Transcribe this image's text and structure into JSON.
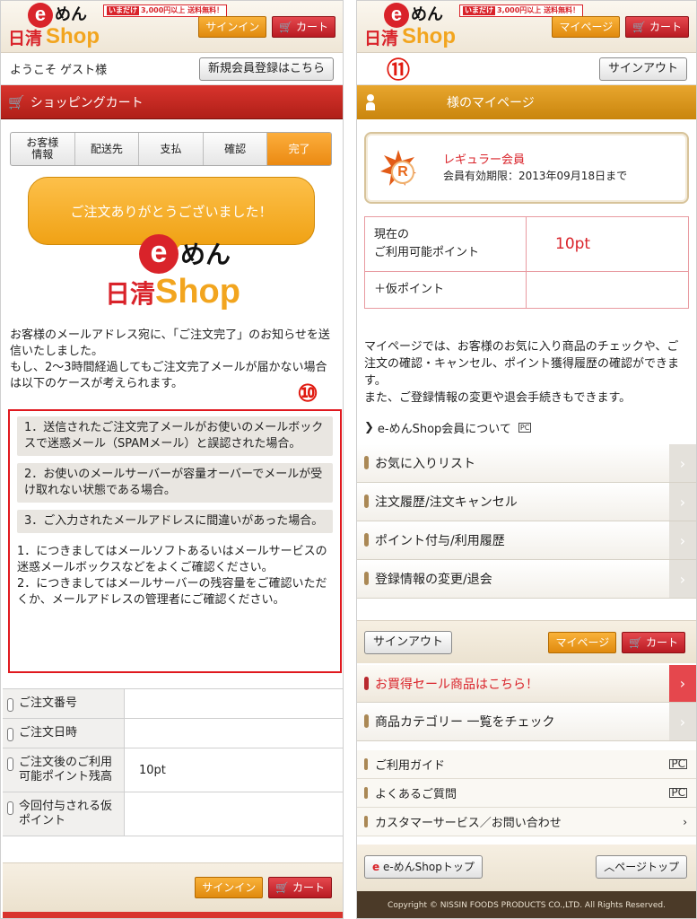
{
  "left": {
    "logo": {
      "mark": "e",
      "men": "めん",
      "nissin": "日清",
      "shop": "Shop",
      "promo_tag": "いまだけ",
      "promo": "3,000円以上 送料無料！"
    },
    "header": {
      "signin": "サインイン",
      "cart": "カート"
    },
    "welcome": "ようこそ ゲスト様",
    "register": "新規会員登録はこちら",
    "cart_bar": "ショッピングカート",
    "steps": [
      "お客様\n情報",
      "配送先",
      "支払",
      "確認",
      "完了"
    ],
    "bubble": "ご注文ありがとうございました！",
    "intro": "お客様のメールアドレス宛に、「ご注文完了」のお知らせを送信いたしました。\nもし、2〜3時間経過してもご注文完了メールが届かない場合は以下のケースが考えられます。",
    "marker": "⑩",
    "cases": [
      "1．送信されたご注文完了メールがお使いのメールボックスで迷惑メール（SPAMメール）と誤認された場合。",
      "2．お使いのメールサーバーが容量オーバーでメールが受け取れない状態である場合。",
      "3．ご入力されたメールアドレスに間違いがあった場合。"
    ],
    "notes": "1．につきましてはメールソフトあるいはメールサービスの迷惑メールボックスなどをよくご確認ください。\n2．につきましてはメールサーバーの残容量をご確認いただくか、メールアドレスの管理者にご確認ください。",
    "table": [
      {
        "label": "ご注文番号",
        "value": ""
      },
      {
        "label": "ご注文日時",
        "value": ""
      },
      {
        "label": "ご注文後のご利用可能ポイント残高",
        "value": "10pt"
      },
      {
        "label": "今回付与される仮ポイント",
        "value": ""
      }
    ],
    "footer": {
      "signin": "サインイン",
      "cart": "カート"
    }
  },
  "right": {
    "logo": {
      "mark": "e",
      "men": "めん",
      "nissin": "日清",
      "shop": "Shop",
      "promo_tag": "いまだけ",
      "promo": "3,000円以上 送料無料！"
    },
    "header": {
      "mypage": "マイページ",
      "cart": "カート"
    },
    "marker": "⑪",
    "signout": "サインアウト",
    "mypage_title": "様のマイページ",
    "member": {
      "badge": "R",
      "rank": "レギュラー会員",
      "expiry": "会員有効期限：2013年09月18日まで"
    },
    "points": [
      {
        "label": "現在の\nご利用可能ポイント",
        "value": "10pt"
      },
      {
        "label": "＋仮ポイント",
        "value": ""
      }
    ],
    "description": "マイページでは、お客様のお気に入り商品のチェックや、ご注文の確認・キャンセル、ポイント獲得履歴の確認ができます。\nまた、ご登録情報の変更や退会手続きもできます。",
    "about_link": "e-めんShop会員について",
    "pc_tag": "PC",
    "menu": [
      "お気に入りリスト",
      "注文履歴/注文キャンセル",
      "ポイント付与/利用履歴",
      "登録情報の変更/退会"
    ],
    "bottom": {
      "signout": "サインアウト",
      "mypage": "マイページ",
      "cart": "カート"
    },
    "sale": "お買得セール商品はこちら！",
    "category": "商品カテゴリー 一覧をチェック",
    "links": [
      {
        "label": "ご利用ガイド",
        "end": "PC"
      },
      {
        "label": "よくあるご質問",
        "end": "PC"
      },
      {
        "label": "カスタマーサービス／お問い合わせ",
        "end": "›"
      }
    ],
    "footer": {
      "top": "e-めんShopトップ",
      "pagetop": "ページトップ"
    },
    "copyright": "Copyright © NISSIN FOODS PRODUCTS CO.,LTD. All Rights Reserved."
  },
  "colors": {
    "brand_red": "#d9232a",
    "brand_orange": "#f2a51f",
    "marker_red": "#e0190f"
  }
}
